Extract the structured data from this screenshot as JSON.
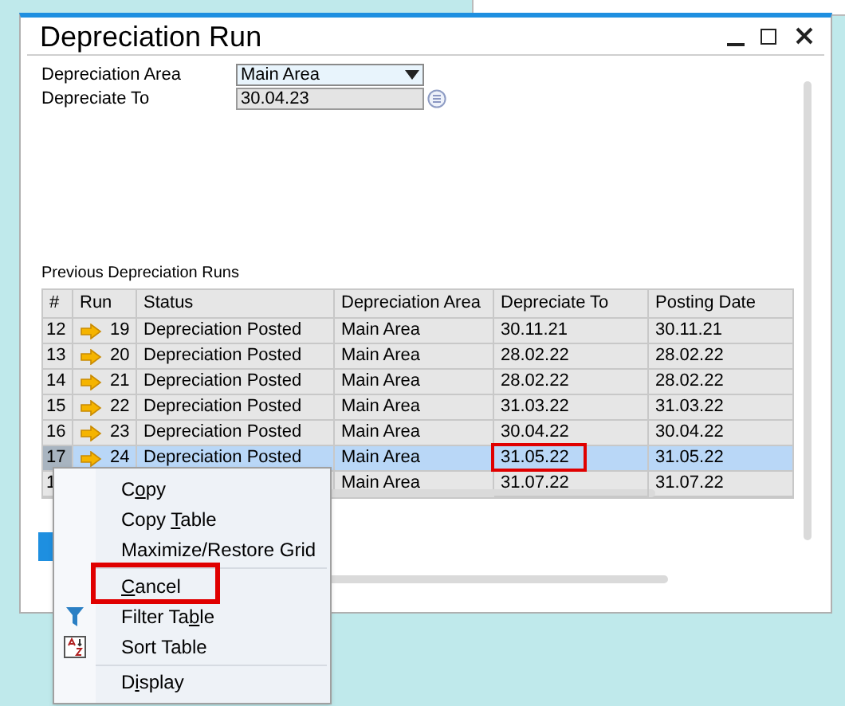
{
  "window": {
    "title": "Depreciation Run"
  },
  "fields": [
    {
      "label": "Depreciation Area",
      "value": "Main Area",
      "kind": "dropdown"
    },
    {
      "label": "Depreciate To",
      "value": "30.04.23",
      "kind": "date"
    }
  ],
  "table": {
    "title": "Previous Depreciation Runs",
    "columns": [
      "#",
      "Run",
      "Status",
      "Depreciation Area",
      "Depreciate To",
      "Posting Date"
    ],
    "rows": [
      {
        "number": "12",
        "run": "19",
        "status": "Depreciation Posted",
        "area": "Main Area",
        "depreciate_to": "30.11.21",
        "posting_date": "30.11.21",
        "selected": false,
        "marked": false
      },
      {
        "number": "13",
        "run": "20",
        "status": "Depreciation Posted",
        "area": "Main Area",
        "depreciate_to": "28.02.22",
        "posting_date": "28.02.22",
        "selected": false,
        "marked": false
      },
      {
        "number": "14",
        "run": "21",
        "status": "Depreciation Posted",
        "area": "Main Area",
        "depreciate_to": "28.02.22",
        "posting_date": "28.02.22",
        "selected": false,
        "marked": false
      },
      {
        "number": "15",
        "run": "22",
        "status": "Depreciation Posted",
        "area": "Main Area",
        "depreciate_to": "31.03.22",
        "posting_date": "31.03.22",
        "selected": false,
        "marked": false
      },
      {
        "number": "16",
        "run": "23",
        "status": "Depreciation Posted",
        "area": "Main Area",
        "depreciate_to": "30.04.22",
        "posting_date": "30.04.22",
        "selected": false,
        "marked": false
      },
      {
        "number": "17",
        "run": "24",
        "status": "Depreciation Posted",
        "area": "Main Area",
        "depreciate_to": "31.05.22",
        "posting_date": "31.05.22",
        "selected": true,
        "marked": true
      },
      {
        "number": "1",
        "area": "Main Area",
        "depreciate_to": "31.07.22",
        "posting_date": "31.07.22",
        "selected": false,
        "marked": false
      }
    ]
  },
  "context_menu": [
    {
      "kind": "item",
      "before": "C",
      "key": "o",
      "after": "py",
      "marked": false
    },
    {
      "kind": "item",
      "before": "Copy ",
      "key": "T",
      "after": "able",
      "marked": false
    },
    {
      "kind": "item",
      "before": "Maximize/Restore Grid",
      "marked": false
    },
    {
      "kind": "separator"
    },
    {
      "kind": "item",
      "key": "C",
      "after": "ancel",
      "marked": true
    },
    {
      "kind": "filter",
      "before": "Filter Ta",
      "key": "b",
      "after": "le",
      "marked": false
    },
    {
      "kind": "sort",
      "before": "Sort Table",
      "marked": false
    },
    {
      "kind": "separator"
    },
    {
      "kind": "item",
      "before": "D",
      "key": "i",
      "after": "splay",
      "marked": false
    }
  ]
}
